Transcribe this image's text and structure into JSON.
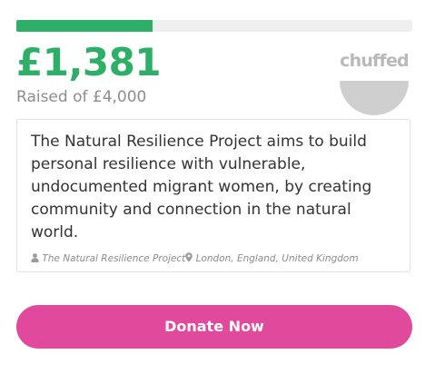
{
  "progress": {
    "fraction": 0.345
  },
  "amount_raised": "£1,381",
  "target_text": "Raised of £4,000",
  "logo": {
    "text": "chuffed",
    "icon": "chuffed-logo"
  },
  "description": "The Natural Resilience Project aims to build personal resilience with vulnerable, undocumented migrant women, by creating community and connection in the natural world.",
  "meta": {
    "organiser_icon": "user-icon",
    "organiser": "The Natural Resilience Project",
    "location_icon": "map-pin-icon",
    "location": "London, England, United Kingdom"
  },
  "donate_label": "Donate Now",
  "colors": {
    "accent_green": "#2eaf68",
    "donate_pink": "#e14a9c"
  }
}
